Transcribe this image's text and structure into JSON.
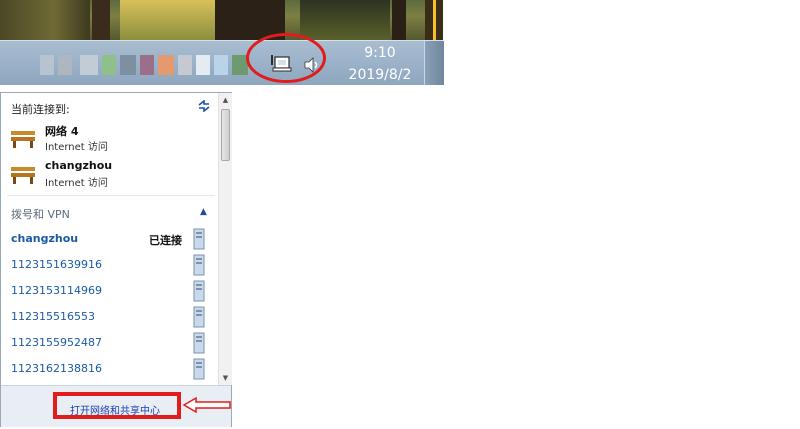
{
  "taskbar": {
    "clock_time": "9:10",
    "clock_date": "2019/8/2",
    "tray_icons": [
      "network-icon",
      "volume-icon"
    ]
  },
  "panel": {
    "current_label": "当前连接到:",
    "connections": [
      {
        "name": "网络  4",
        "access": "Internet 访问"
      },
      {
        "name": "changzhou",
        "access": "Internet 访问"
      }
    ],
    "section_label": "拨号和 VPN",
    "vpn_items": [
      {
        "name": "changzhou",
        "status": "已连接"
      },
      {
        "name": "1123151639916",
        "status": ""
      },
      {
        "name": "1123153114969",
        "status": ""
      },
      {
        "name": "112315516553",
        "status": ""
      },
      {
        "name": "1123155952487",
        "status": ""
      },
      {
        "name": "1123162138816",
        "status": ""
      }
    ],
    "footer_link": "打开网络和共享中心"
  },
  "colors": {
    "highlight": "#e21b1b",
    "link": "#1a5aa6"
  }
}
